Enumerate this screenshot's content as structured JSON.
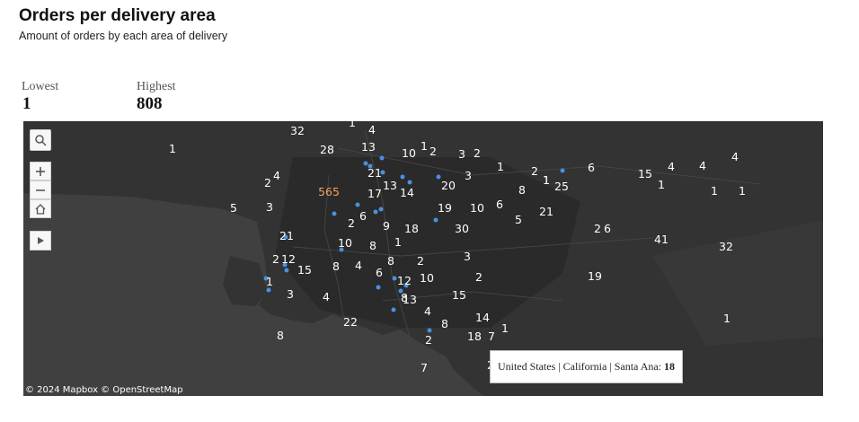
{
  "header": {
    "title": "Orders per delivery area",
    "subtitle": "Amount of orders by each area of delivery"
  },
  "stats": {
    "lowest_label": "Lowest",
    "lowest_value": "1",
    "highest_label": "Highest",
    "highest_value": "808"
  },
  "map": {
    "attribution": "© 2024 Mapbox  © OpenStreetMap",
    "controls": [
      "search-icon",
      "zoom-in-icon",
      "zoom-out-icon",
      "home-icon",
      "play-icon"
    ],
    "colors": {
      "background": "#2f2f2f",
      "land": "#333333",
      "water": "#404040",
      "dot": "#4a90e2",
      "label": "#ffffff"
    },
    "tooltip": {
      "text": "United States | California | Santa Ana:",
      "value": "18"
    },
    "area_counts": [
      "32",
      "1",
      "4",
      "1",
      "28",
      "13",
      "10",
      "1",
      "2",
      "3",
      "2",
      "1",
      "2",
      "1",
      "6",
      "15",
      "4",
      "4",
      "4",
      "2",
      "4",
      "21",
      "20",
      "3",
      "565",
      "17",
      "13",
      "14",
      "5",
      "3",
      "19",
      "10",
      "6",
      "8",
      "1",
      "25",
      "1",
      "1",
      "1",
      "5",
      "6",
      "2",
      "9",
      "18",
      "30",
      "21",
      "2",
      "6",
      "41",
      "21",
      "10",
      "8",
      "1",
      "3",
      "32",
      "2",
      "12",
      "2",
      "15",
      "8",
      "4",
      "8",
      "6",
      "12",
      "10",
      "2",
      "19",
      "1",
      "3",
      "4",
      "15",
      "8",
      "13",
      "22",
      "4",
      "14",
      "8",
      "18",
      "1",
      "7",
      "2",
      "1",
      "8",
      "7",
      "2"
    ]
  }
}
